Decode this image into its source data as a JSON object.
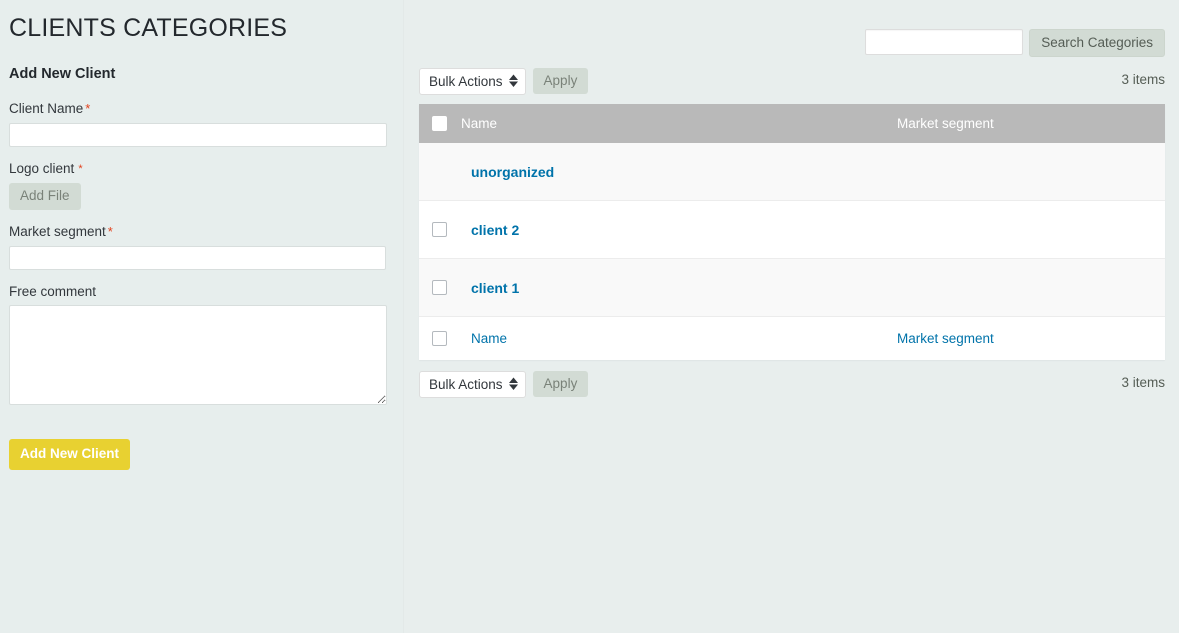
{
  "page": {
    "title": "CLIENTS CATEGORIES"
  },
  "search": {
    "value": "",
    "placeholder": "",
    "button_label": "Search Categories"
  },
  "form": {
    "heading": "Add New Client",
    "required_marker": "*",
    "fields": {
      "client_name": {
        "label": "Client Name",
        "value": "",
        "placeholder": "",
        "required": true
      },
      "logo_client": {
        "label": "Logo client",
        "button_label": "Add File",
        "required": true
      },
      "market_segment": {
        "label": "Market segment",
        "value": "",
        "placeholder": "",
        "required": true
      },
      "free_comment": {
        "label": "Free comment",
        "value": "",
        "placeholder": "",
        "required": false
      }
    },
    "submit_label": "Add New Client"
  },
  "list": {
    "bulk_actions_label": "Bulk Actions",
    "apply_label": "Apply",
    "items_count_top": "3 items",
    "items_count_bottom": "3 items",
    "columns": {
      "name": "Name",
      "market_segment": "Market segment"
    },
    "rows": [
      {
        "name": "unorganized",
        "market_segment": "",
        "has_checkbox": false
      },
      {
        "name": "client 2",
        "market_segment": "",
        "has_checkbox": true
      },
      {
        "name": "client 1",
        "market_segment": "",
        "has_checkbox": true
      }
    ],
    "footer": {
      "name": "Name",
      "market_segment": "Market segment"
    }
  },
  "colors": {
    "page_background": "#e7eeed",
    "table_header_background": "#b9b9b9",
    "link_blue": "#0073aa",
    "submit_yellow": "#e8d131",
    "button_grey_green": "#d2dbd4",
    "required_red": "#e2401c"
  }
}
